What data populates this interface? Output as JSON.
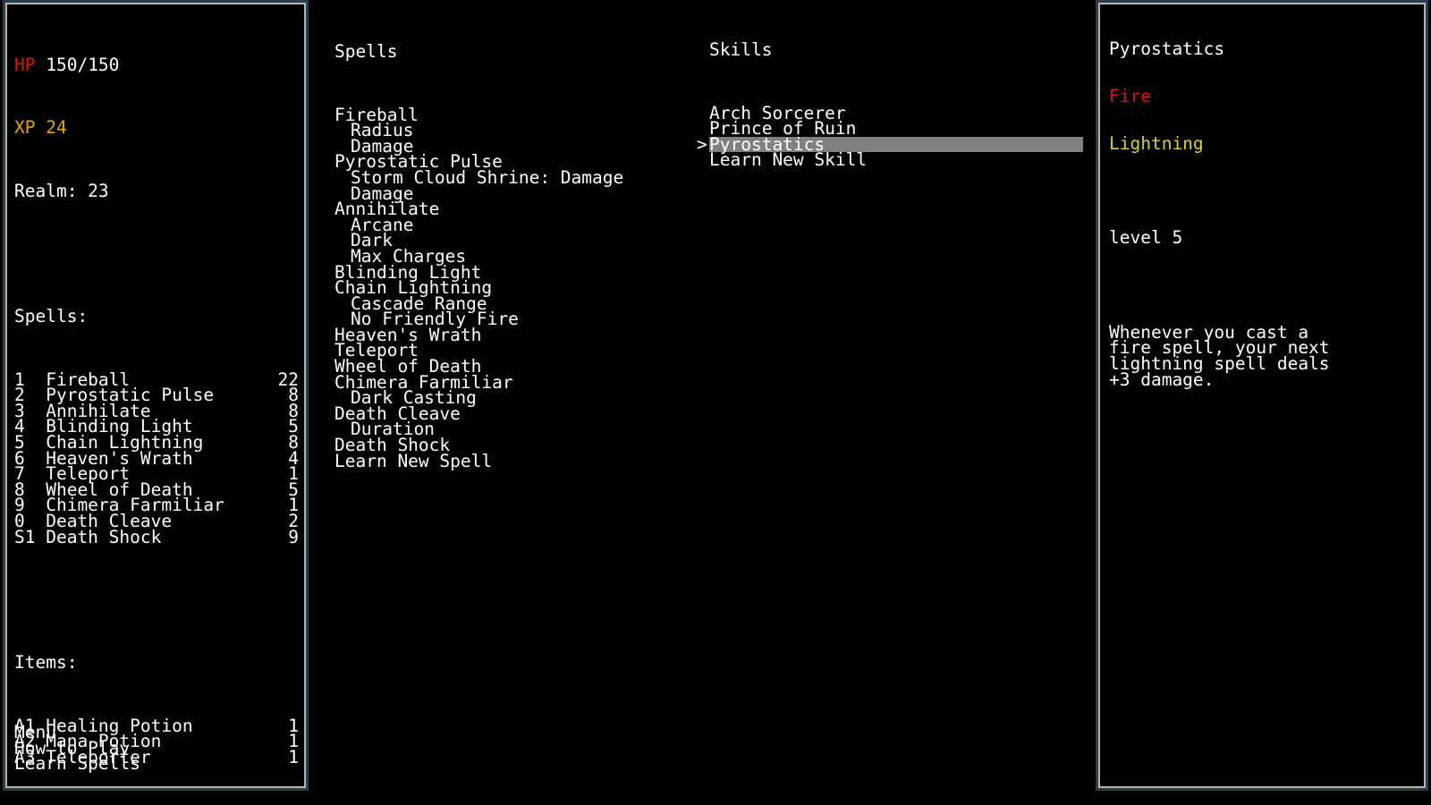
{
  "theme": {
    "background": "#000000",
    "text": "#ffffff",
    "border_inner": "#b4b4ac",
    "border_outer": "#2c3f4e",
    "highlight": "#808080",
    "hp_color": "#dc1414",
    "xp_color": "#e0a800",
    "fire_color": "#dc1414",
    "lightning_color": "#e0d020"
  },
  "status_panel": {
    "hp_label": "HP",
    "hp_value": "150/150",
    "xp_label": "XP",
    "xp_value": "24",
    "realm_line": "Realm: 23",
    "spells_heading": "Spells:",
    "spells": [
      {
        "key": "1",
        "name": "Fireball",
        "count": "22"
      },
      {
        "key": "2",
        "name": "Pyrostatic Pulse",
        "count": "8"
      },
      {
        "key": "3",
        "name": "Annihilate",
        "count": "8"
      },
      {
        "key": "4",
        "name": "Blinding Light",
        "count": "5"
      },
      {
        "key": "5",
        "name": "Chain Lightning",
        "count": "8"
      },
      {
        "key": "6",
        "name": "Heaven's Wrath",
        "count": "4"
      },
      {
        "key": "7",
        "name": "Teleport",
        "count": "1"
      },
      {
        "key": "8",
        "name": "Wheel of Death",
        "count": "5"
      },
      {
        "key": "9",
        "name": "Chimera Farmiliar",
        "count": "1"
      },
      {
        "key": "0",
        "name": "Death Cleave",
        "count": "2"
      },
      {
        "key": "S1",
        "name": "Death Shock",
        "count": "9"
      }
    ],
    "items_heading": "Items:",
    "items": [
      {
        "key": "A1",
        "name": "Healing Potion",
        "count": "1"
      },
      {
        "key": "A2",
        "name": "Mana Potion",
        "count": "1"
      },
      {
        "key": "A3",
        "name": "Teleporter",
        "count": "1"
      }
    ],
    "menu": [
      "Menu",
      "How to Play",
      "Learn Spells"
    ]
  },
  "spells_column": {
    "heading": "Spells",
    "entries": [
      {
        "label": "Fireball",
        "sub": false
      },
      {
        "label": "Radius",
        "sub": true
      },
      {
        "label": "Damage",
        "sub": true
      },
      {
        "label": "Pyrostatic Pulse",
        "sub": false
      },
      {
        "label": "Storm Cloud Shrine: Damage",
        "sub": true
      },
      {
        "label": "Damage",
        "sub": true
      },
      {
        "label": "Annihilate",
        "sub": false
      },
      {
        "label": "Arcane",
        "sub": true
      },
      {
        "label": "Dark",
        "sub": true
      },
      {
        "label": "Max Charges",
        "sub": true
      },
      {
        "label": "Blinding Light",
        "sub": false
      },
      {
        "label": "Chain Lightning",
        "sub": false
      },
      {
        "label": "Cascade Range",
        "sub": true
      },
      {
        "label": "No Friendly Fire",
        "sub": true
      },
      {
        "label": "Heaven's Wrath",
        "sub": false
      },
      {
        "label": "Teleport",
        "sub": false
      },
      {
        "label": "Wheel of Death",
        "sub": false
      },
      {
        "label": "Chimera Farmiliar",
        "sub": false
      },
      {
        "label": "Dark Casting",
        "sub": true
      },
      {
        "label": "Death Cleave",
        "sub": false
      },
      {
        "label": "Duration",
        "sub": true
      },
      {
        "label": "Death Shock",
        "sub": false
      },
      {
        "label": "Learn New Spell",
        "sub": false
      }
    ]
  },
  "skills_column": {
    "heading": "Skills",
    "cursor_glyph": ">",
    "entries": [
      {
        "label": "Arch Sorcerer",
        "selected": false
      },
      {
        "label": "Prince of Ruin",
        "selected": false
      },
      {
        "label": "Pyrostatics",
        "selected": true
      },
      {
        "label": "Learn New Skill",
        "selected": false
      }
    ]
  },
  "detail_panel": {
    "title": "Pyrostatics",
    "tag_fire": "Fire",
    "tag_lightning": "Lightning",
    "level": "level 5",
    "description_lines": [
      "Whenever you cast a",
      "fire spell, your next",
      "lightning spell deals",
      "+3 damage."
    ]
  }
}
